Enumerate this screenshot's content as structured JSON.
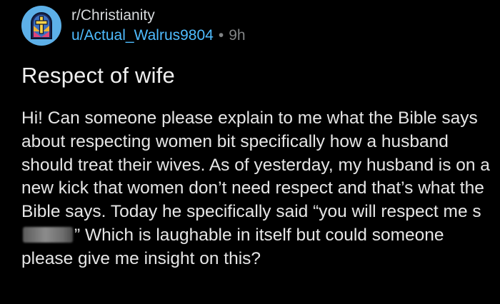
{
  "post": {
    "subreddit": "r/Christianity",
    "author": "u/Actual_Walrus9804",
    "separator": "•",
    "time": "9h",
    "title": "Respect of wife",
    "body_before_censor": "Hi! Can someone please explain to me what the Bible says about respecting women bit specifically how a husband should treat their wives. As of yesterday, my husband is on a new kick that women don’t need respect and that’s what the Bible says. Today he specifically said “you will respect me s",
    "body_after_censor": "” Which is laughable in itself but could someone please give me insight on this?"
  },
  "colors": {
    "background": "#000000",
    "avatar_bg": "#5db0e8",
    "author_link": "#4fbcff",
    "muted": "#818384"
  },
  "icons": {
    "avatar": "stained-glass-cross-icon"
  }
}
